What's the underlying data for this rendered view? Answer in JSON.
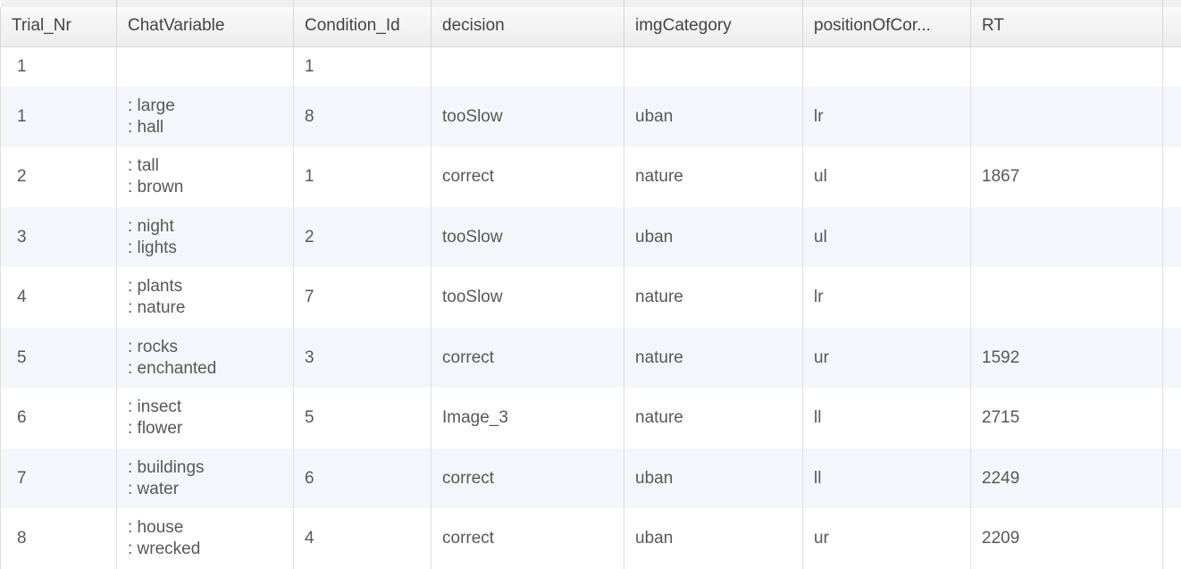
{
  "table": {
    "columns": [
      {
        "key": "trial_nr",
        "label": "Trial_Nr"
      },
      {
        "key": "chat_var",
        "label": "ChatVariable"
      },
      {
        "key": "condition_id",
        "label": "Condition_Id"
      },
      {
        "key": "decision",
        "label": "decision"
      },
      {
        "key": "img_category",
        "label": "imgCategory"
      },
      {
        "key": "position",
        "label": "positionOfCor..."
      },
      {
        "key": "rt",
        "label": "RT"
      },
      {
        "key": "extra",
        "label": ""
      }
    ],
    "rows": [
      {
        "trial_nr": "1",
        "chat_var": "",
        "condition_id": "1",
        "decision": "",
        "img_category": "",
        "position": "",
        "rt": "",
        "extra": ""
      },
      {
        "trial_nr": "1",
        "chat_var": ": large\n: hall",
        "condition_id": "8",
        "decision": "tooSlow",
        "img_category": "uban",
        "position": "lr",
        "rt": "",
        "extra": ""
      },
      {
        "trial_nr": "2",
        "chat_var": ": tall\n: brown",
        "condition_id": "1",
        "decision": "correct",
        "img_category": "nature",
        "position": "ul",
        "rt": "1867",
        "extra": ""
      },
      {
        "trial_nr": "3",
        "chat_var": ": night\n: lights",
        "condition_id": "2",
        "decision": "tooSlow",
        "img_category": "uban",
        "position": "ul",
        "rt": "",
        "extra": ""
      },
      {
        "trial_nr": "4",
        "chat_var": ": plants\n: nature",
        "condition_id": "7",
        "decision": "tooSlow",
        "img_category": "nature",
        "position": "lr",
        "rt": "",
        "extra": ""
      },
      {
        "trial_nr": "5",
        "chat_var": ": rocks\n: enchanted",
        "condition_id": "3",
        "decision": "correct",
        "img_category": "nature",
        "position": "ur",
        "rt": "1592",
        "extra": ""
      },
      {
        "trial_nr": "6",
        "chat_var": ": insect\n: flower",
        "condition_id": "5",
        "decision": "Image_3",
        "img_category": "nature",
        "position": "ll",
        "rt": "2715",
        "extra": ""
      },
      {
        "trial_nr": "7",
        "chat_var": ": buildings\n: water",
        "condition_id": "6",
        "decision": "correct",
        "img_category": "uban",
        "position": "ll",
        "rt": "2249",
        "extra": ""
      },
      {
        "trial_nr": "8",
        "chat_var": ": house\n: wrecked",
        "condition_id": "4",
        "decision": "correct",
        "img_category": "uban",
        "position": "ur",
        "rt": "2209",
        "extra": ""
      }
    ]
  }
}
